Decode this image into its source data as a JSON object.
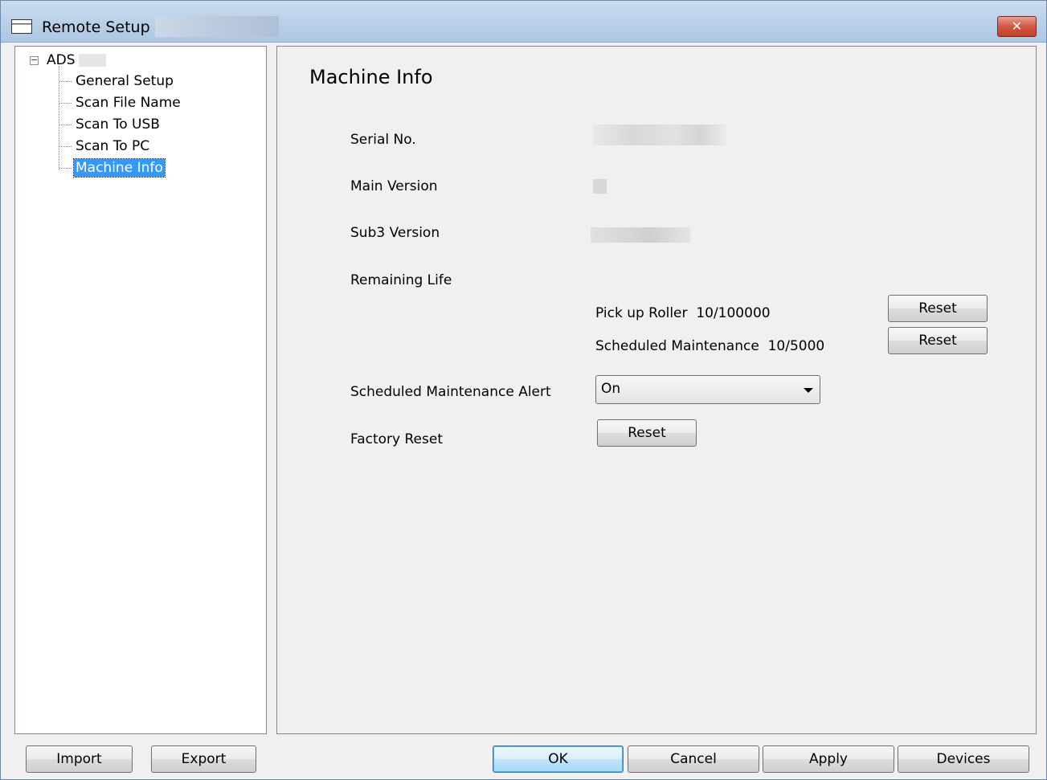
{
  "window": {
    "title": "Remote Setup -",
    "close_glyph": "✕"
  },
  "tree": {
    "root_label": "ADS",
    "items": [
      {
        "label": "General Setup",
        "selected": false
      },
      {
        "label": "Scan File Name",
        "selected": false
      },
      {
        "label": "Scan To USB",
        "selected": false
      },
      {
        "label": "Scan To PC",
        "selected": false
      },
      {
        "label": "Machine Info",
        "selected": true
      }
    ]
  },
  "main": {
    "heading": "Machine Info",
    "serial_label": "Serial No.",
    "main_version_label": "Main Version",
    "sub3_version_label": "Sub3 Version",
    "remaining_life_label": "Remaining Life",
    "pickup_roller": "Pick up Roller  10/100000",
    "scheduled_maintenance": "Scheduled Maintenance  10/5000",
    "reset_label": "Reset",
    "alert_label": "Scheduled Maintenance Alert",
    "alert_value": "On",
    "factory_reset_label": "Factory Reset"
  },
  "footer": {
    "import_label": "Import",
    "export_label": "Export",
    "ok_label": "OK",
    "cancel_label": "Cancel",
    "apply_label": "Apply",
    "devices_label": "Devices"
  }
}
